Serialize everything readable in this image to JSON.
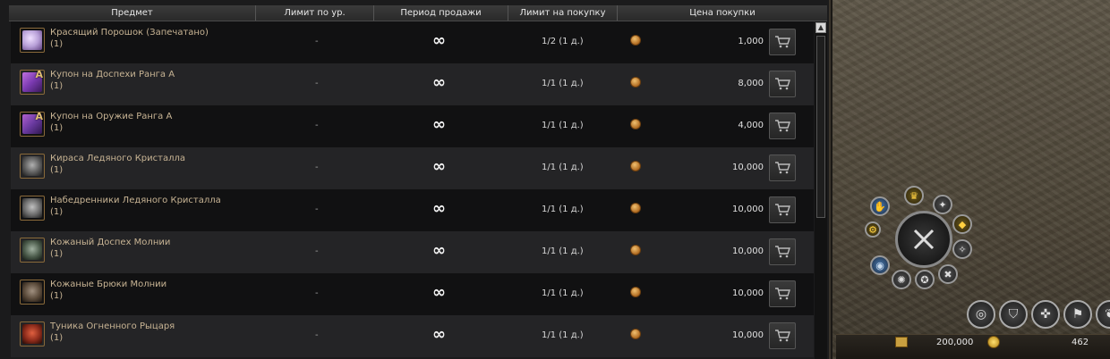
{
  "columns": {
    "item": "Предмет",
    "level_limit": "Лимит по ур.",
    "sale_period": "Период продажи",
    "purchase_limit": "Лимит на покупку",
    "price": "Цена покупки"
  },
  "items": [
    {
      "name": "Красящий Порошок (Запечатано)",
      "qty": "(1)",
      "level_limit": "-",
      "period": "∞",
      "purchase_limit": "1/2 (1 д.)",
      "price": "1,000",
      "icon": "crystal-powder-icon",
      "color": "#b8a0d8",
      "rank": ""
    },
    {
      "name": "Купон на Доспехи Ранга А",
      "qty": "(1)",
      "level_limit": "-",
      "period": "∞",
      "purchase_limit": "1/1 (1 д.)",
      "price": "8,000",
      "icon": "armor-coupon-icon",
      "color": "#7a3ab0",
      "rank": "A"
    },
    {
      "name": "Купон на Оружие Ранга А",
      "qty": "(1)",
      "level_limit": "-",
      "period": "∞",
      "purchase_limit": "1/1 (1 д.)",
      "price": "4,000",
      "icon": "weapon-coupon-icon",
      "color": "#6a3aa0",
      "rank": "A"
    },
    {
      "name": "Кираса Ледяного Кристалла",
      "qty": "(1)",
      "level_limit": "-",
      "period": "∞",
      "purchase_limit": "1/1 (1 д.)",
      "price": "10,000",
      "icon": "cuirass-icon",
      "color": "#5a5a5a",
      "rank": ""
    },
    {
      "name": "Набедренники Ледяного Кристалла",
      "qty": "(1)",
      "level_limit": "-",
      "period": "∞",
      "purchase_limit": "1/1 (1 д.)",
      "price": "10,000",
      "icon": "leggings-icon",
      "color": "#6a6a6a",
      "rank": ""
    },
    {
      "name": "Кожаный Доспех Молнии",
      "qty": "(1)",
      "level_limit": "-",
      "period": "∞",
      "purchase_limit": "1/1 (1 д.)",
      "price": "10,000",
      "icon": "leather-armor-icon",
      "color": "#4a5a4a",
      "rank": ""
    },
    {
      "name": "Кожаные Брюки Молнии",
      "qty": "(1)",
      "level_limit": "-",
      "period": "∞",
      "purchase_limit": "1/1 (1 д.)",
      "price": "10,000",
      "icon": "leather-pants-icon",
      "color": "#5a4a3a",
      "rank": ""
    },
    {
      "name": "Туника Огненного Рыцаря",
      "qty": "(1)",
      "level_limit": "-",
      "period": "∞",
      "purchase_limit": "1/1 (1 д.)",
      "price": "10,000",
      "icon": "tunic-icon",
      "color": "#8a2a1a",
      "rank": ""
    }
  ],
  "currency": {
    "adena": "200,000",
    "coins": "462"
  }
}
